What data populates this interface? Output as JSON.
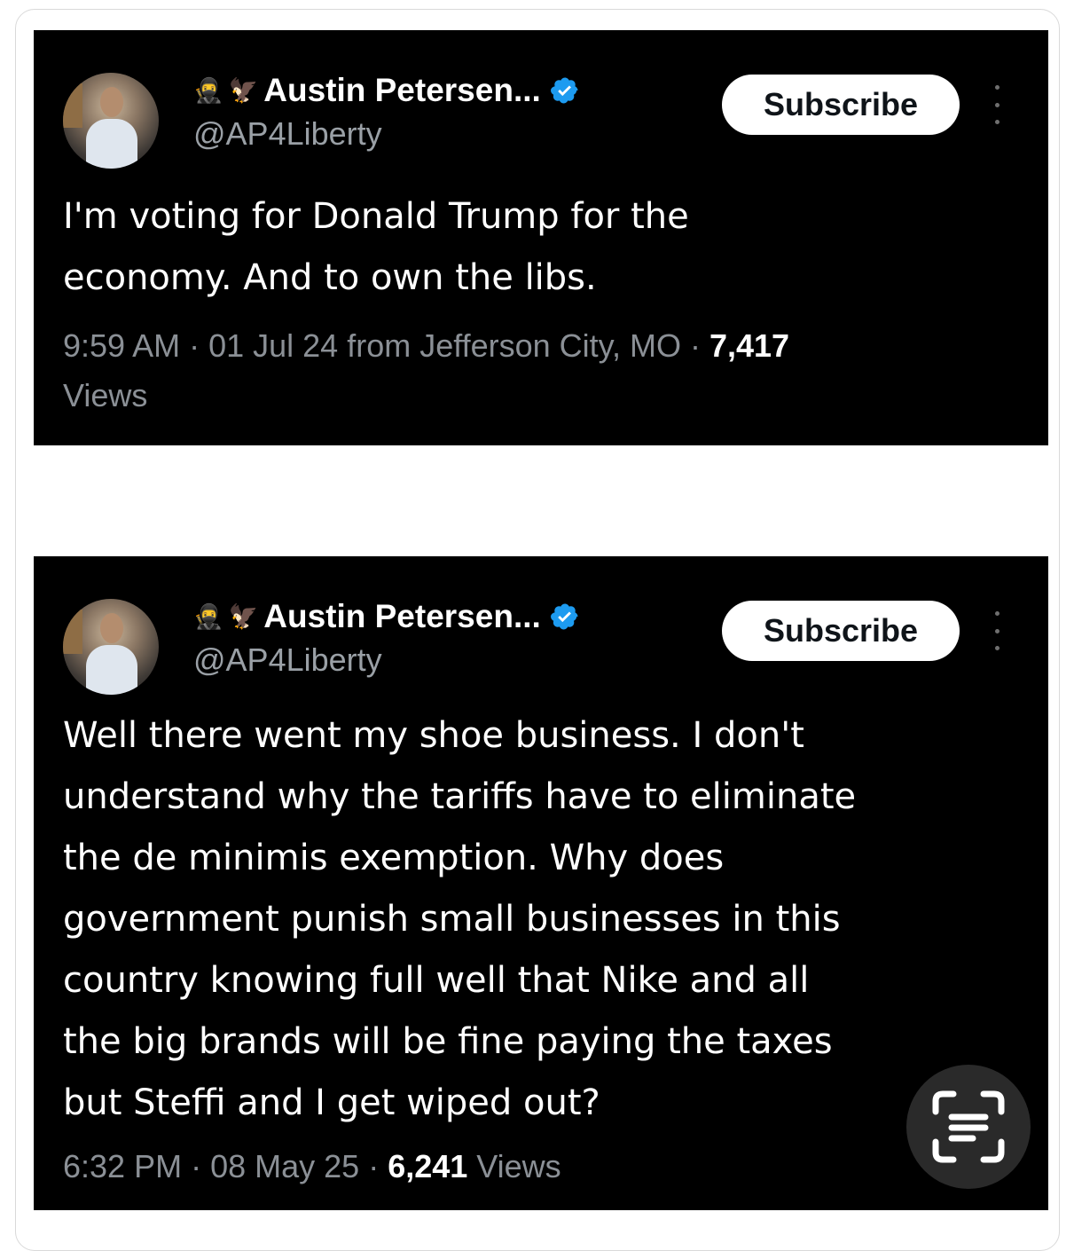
{
  "tweets": [
    {
      "author": {
        "emoji_1": "🥷",
        "emoji_2": "🦅",
        "name": "Austin Petersen...",
        "handle": "@AP4Liberty",
        "verified": true
      },
      "subscribe_label": "Subscribe",
      "text": "I'm voting for Donald Trump for the\neconomy. And to own the libs.",
      "meta": {
        "time": "9:59 AM",
        "separator": " · ",
        "date": "01 Jul 24",
        "location": " from Jefferson City, MO",
        "views_count": "7,417",
        "views_label": "Views"
      }
    },
    {
      "author": {
        "emoji_1": "🥷",
        "emoji_2": "🦅",
        "name": "Austin Petersen...",
        "handle": "@AP4Liberty",
        "verified": true
      },
      "subscribe_label": "Subscribe",
      "text": "Well there went my shoe business. I don't\nunderstand why the tariffs have to eliminate\nthe de minimis exemption. Why does\ngovernment punish small businesses in this\ncountry knowing full well that Nike and all\nthe big brands will be fine paying the taxes\nbut Steffi and I get wiped out?",
      "meta": {
        "time": "6:32 PM",
        "separator": " · ",
        "date": "08 May 25",
        "views_count": "6,241",
        "views_label": "Views"
      }
    }
  ],
  "colors": {
    "tweet_background": "#000000",
    "verified_badge": "#1d9bf0",
    "meta_text": "#8b9096",
    "page_background": "#ffffff"
  },
  "icons": {
    "verified": "verified-badge-icon",
    "more": "more-vertical-icon",
    "scan": "text-scan-icon"
  }
}
